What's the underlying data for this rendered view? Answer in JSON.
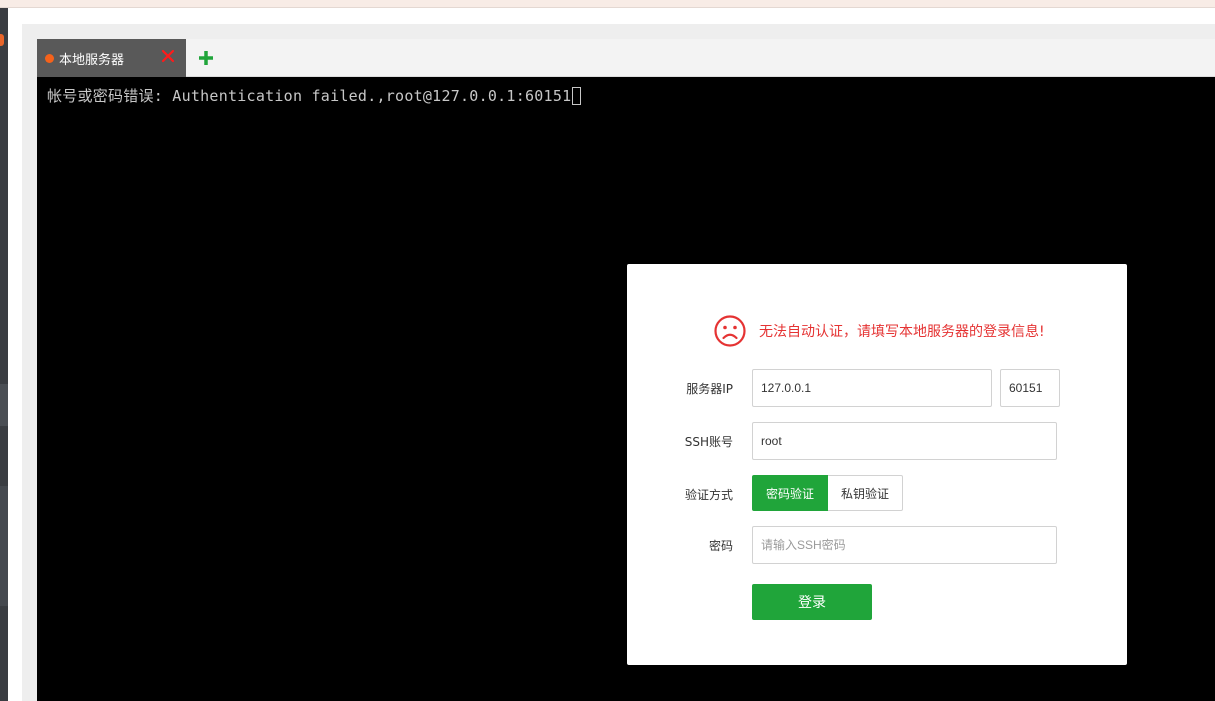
{
  "tabs": [
    {
      "label": "本地服务器",
      "status_color": "#f5621b",
      "active": true
    }
  ],
  "icons": {
    "tab_close": "close-icon",
    "add_tab": "plus-icon",
    "dialog_status": "sad-face-icon"
  },
  "terminal": {
    "line": "帐号或密码错误: Authentication failed.,root@127.0.0.1:60151"
  },
  "dialog": {
    "message": "无法自动认证，请填写本地服务器的登录信息!",
    "message_color": "#e53333",
    "server_ip_label": "服务器IP",
    "server_ip_value": "127.0.0.1",
    "port_value": "60151",
    "ssh_account_label": "SSH账号",
    "ssh_account_value": "root",
    "auth_method_label": "验证方式",
    "auth_methods": [
      "密码验证",
      "私钥验证"
    ],
    "auth_selected": "密码验证",
    "password_label": "密码",
    "password_placeholder": "请输入SSH密码",
    "login_label": "登录",
    "accent_color": "#20a53a"
  }
}
